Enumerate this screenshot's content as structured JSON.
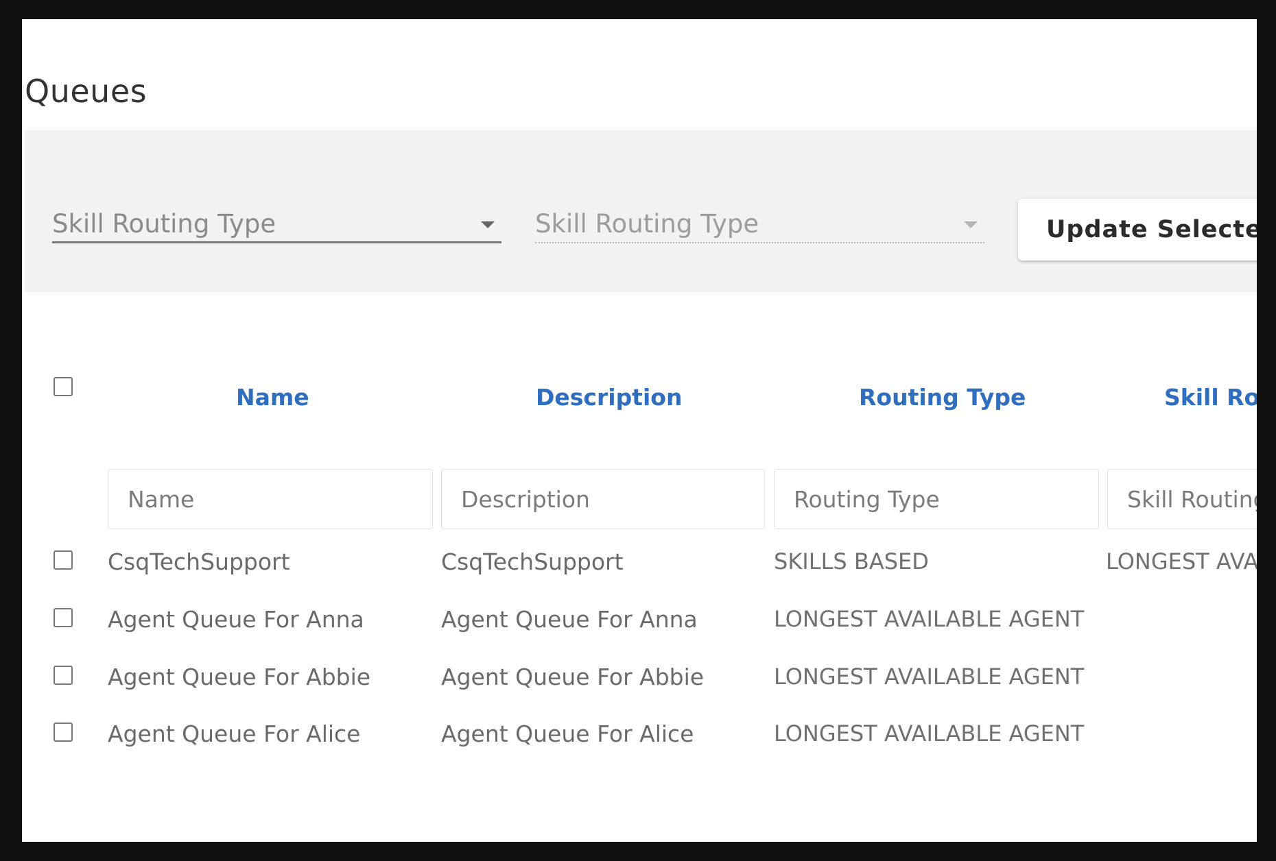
{
  "page": {
    "title": "Queues"
  },
  "toolbar": {
    "select_1": {
      "label": "Skill Routing Type"
    },
    "select_2": {
      "label": "Skill Routing Type"
    },
    "update_button": "Update Selected"
  },
  "table": {
    "columns": [
      {
        "header": "Name",
        "filter_placeholder": "Name"
      },
      {
        "header": "Description",
        "filter_placeholder": "Description"
      },
      {
        "header": "Routing Type",
        "filter_placeholder": "Routing Type"
      },
      {
        "header": "Skill Rou",
        "filter_placeholder": "Skill Routing"
      }
    ],
    "rows": [
      {
        "name": "CsqTechSupport",
        "description": "CsqTechSupport",
        "routing_type": "SKILLS BASED",
        "skill_routing": "LONGEST AVA"
      },
      {
        "name": "Agent Queue For Anna",
        "description": "Agent Queue For Anna",
        "routing_type": "LONGEST AVAILABLE AGENT",
        "skill_routing": ""
      },
      {
        "name": "Agent Queue For Abbie",
        "description": "Agent Queue For Abbie",
        "routing_type": "LONGEST AVAILABLE AGENT",
        "skill_routing": ""
      },
      {
        "name": "Agent Queue For Alice",
        "description": "Agent Queue For Alice",
        "routing_type": "LONGEST AVAILABLE AGENT",
        "skill_routing": ""
      }
    ]
  },
  "colors": {
    "header_text": "#2f6ebe",
    "toolbar_bg": "#f2f2f2",
    "body_text": "#6a6a6a"
  }
}
